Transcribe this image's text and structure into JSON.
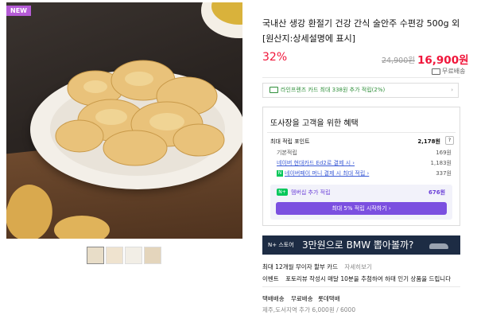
{
  "badge": "NEW",
  "product": {
    "title_line1": "국내산 생강 환절기 건강 간식 술안주 수편강 500g 외",
    "title_line2": "[원산지:상세설명에 표시]",
    "discount": "32%",
    "original_price": "24,900원",
    "price": "16,900원",
    "shipping": "무료배송"
  },
  "card_offer": {
    "label": "라인프렌즈 카드 최대 338원 추가 적립(2%)",
    "chevron": "›"
  },
  "benefits": {
    "title": "또사장을 고객을 위한 혜택",
    "max_points_label": "최대 적립 포인트",
    "max_points_value": "2,178원",
    "help": "?",
    "rows": [
      {
        "label": "기본적립",
        "value": "169원"
      },
      {
        "label": "네이버 현대카드 Ed2로 결제 시 ›",
        "value": "1,183원"
      },
      {
        "label": "네이버페이 머니 결제 시 최대 적립 ›",
        "value": "337원"
      }
    ],
    "membership_icon": "N+",
    "membership_label": "멤버십 추가 적립",
    "membership_value": "676원",
    "membership_button": "최대 5% 적립 시작하기 ›"
  },
  "banner": {
    "store_label": "N+ 스토어",
    "text": "3만원으로 BMW 뽑아볼까?"
  },
  "purchase_info": {
    "card_label": "최대 12개월 무이자 할부 카드",
    "card_link": "자세히보기",
    "event_label": "이벤트",
    "event_text": "포토리뷰 작성시 매달 10분을 추첨하여 하태 인기 상품을 드립니다",
    "delivery_label": "택배배송",
    "delivery_fee": "무료배송",
    "delivery_company": "롯데택배",
    "extra_fee": "제주,도서지역 추가 6,000원 / 6000"
  },
  "icons": {
    "truck": "truck-icon",
    "card": "card-icon",
    "naverpay": "naverpay-icon",
    "car": "car-icon"
  },
  "colors": {
    "price_red": "#f0153a",
    "green": "#2f8f3a",
    "purple": "#7b4fe0",
    "banner_bg": "#1d2c44",
    "badge_purple": "#b55cd6"
  }
}
